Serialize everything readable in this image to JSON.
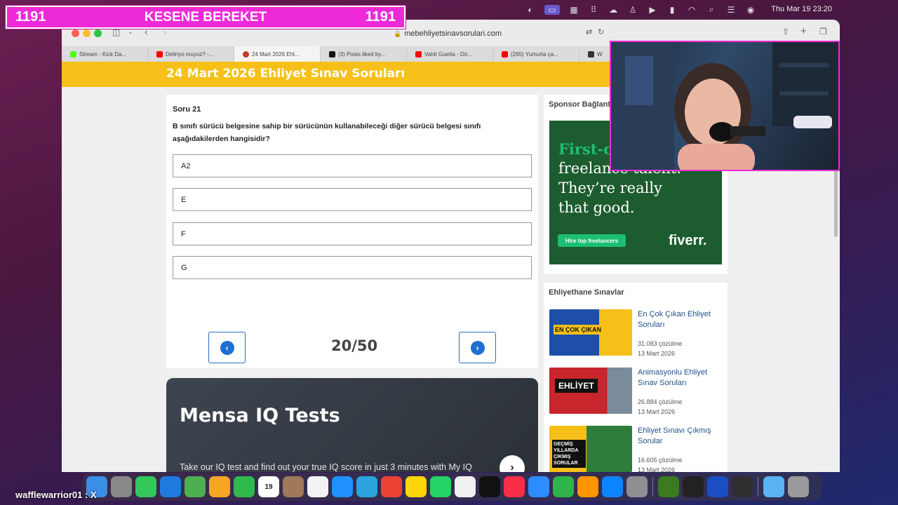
{
  "overlay": {
    "left_count": "1191",
    "title": "KESENE BEREKET",
    "right_count": "1191"
  },
  "menubar": {
    "clock": "Thu Mar 19  23:20"
  },
  "browser": {
    "url": "mebehliyetsinavsorulari.com",
    "tabs": [
      {
        "label": "Stream - Kick Da...",
        "color": "#53fc18"
      },
      {
        "label": "Deliriyo muyuz? -...",
        "color": "#ff0000"
      },
      {
        "label": "24 Mart 2026 Ehl...",
        "color": "#c0392b"
      },
      {
        "label": "(3) Posts liked by...",
        "color": "#111111"
      },
      {
        "label": "Vahit Guetta - Dö...",
        "color": "#ff0000"
      },
      {
        "label": "(265) Yumurta ça...",
        "color": "#ff0000"
      },
      {
        "label": "W",
        "color": "#333333"
      }
    ]
  },
  "page": {
    "title": "24 Mart 2026 Ehliyet Sınav Soruları",
    "question": {
      "number": "Soru 21",
      "text": "B sınıfı sürücü belgesine sahip bir sürücünün kullanabileceği diğer sürücü belgesi sınıfı aşağıdakilerden hangisidir?",
      "options": [
        "A2",
        "E",
        "F",
        "G"
      ]
    },
    "progress": "20/50",
    "mensa": {
      "title": "Mensa IQ Tests",
      "desc": "Take our IQ test and find out your true IQ score in just 3 minutes with My IQ"
    },
    "sponsor": {
      "heading": "Sponsor Bağlantı",
      "ad": {
        "line1": "First-cl",
        "line2": "freelance talent.",
        "line3": "They’re really",
        "line4": "that good.",
        "button": "Hire top freelancers",
        "logo": "fiverr."
      }
    },
    "exams": {
      "heading": "Ehliyethane Sınavlar",
      "items": [
        {
          "title": "En Çok Çıkan Ehliyet Soruları",
          "count": "31.083 çözülme",
          "date": "13 Mart 2026",
          "thumb": "EN ÇOK ÇIKAN"
        },
        {
          "title": "Animasyonlu Ehliyet Sınav Soruları",
          "count": "26.884 çözülme",
          "date": "13 Mart 2026",
          "thumb": "EHLİYET"
        },
        {
          "title": "Ehliyet Sınavı Çıkmış Sorular",
          "count": "16.605 çözülme",
          "date": "13 Mart 2026",
          "thumb": "GEÇMİŞ YILLARDA ÇIKMIŞ SORULAR"
        }
      ]
    }
  },
  "chat": {
    "text": "wafflewarrior01 : X"
  },
  "dock": {
    "apps": [
      {
        "name": "finder-icon",
        "color": "#3a8ee6"
      },
      {
        "name": "launchpad-icon",
        "color": "#888888"
      },
      {
        "name": "messages-icon",
        "color": "#34c759"
      },
      {
        "name": "mail-icon",
        "color": "#1f7ae0"
      },
      {
        "name": "maps-icon",
        "color": "#4caf50"
      },
      {
        "name": "photos-icon",
        "color": "#f5a623"
      },
      {
        "name": "facetime-icon",
        "color": "#30b94d"
      },
      {
        "name": "calendar-icon",
        "color": "#ffffff"
      },
      {
        "name": "notes-brown-icon",
        "color": "#a0785a"
      },
      {
        "name": "reminders-icon",
        "color": "#f2f2f2"
      },
      {
        "name": "safari-icon",
        "color": "#1e90ff"
      },
      {
        "name": "telegram-icon",
        "color": "#2aa3de"
      },
      {
        "name": "chrome-icon",
        "color": "#ea4335"
      },
      {
        "name": "notes-icon",
        "color": "#ffd60a"
      },
      {
        "name": "whatsapp-icon",
        "color": "#25d366"
      },
      {
        "name": "freeform-icon",
        "color": "#f0f0f0"
      },
      {
        "name": "appletv-icon",
        "color": "#111111"
      },
      {
        "name": "music-icon",
        "color": "#fa2d48"
      },
      {
        "name": "keynote-icon",
        "color": "#2d8cff"
      },
      {
        "name": "numbers-icon",
        "color": "#2fb34a"
      },
      {
        "name": "pages-icon",
        "color": "#ff9500"
      },
      {
        "name": "appstore-icon",
        "color": "#0d84ff"
      },
      {
        "name": "settings-icon",
        "color": "#8e8e93"
      },
      {
        "name": "mt-icon",
        "color": "#3b7a1e"
      },
      {
        "name": "epicgames-icon",
        "color": "#222222"
      },
      {
        "name": "wd-icon",
        "color": "#1a4fc4"
      },
      {
        "name": "obs-icon",
        "color": "#302e31"
      },
      {
        "name": "folder-icon",
        "color": "#5ab3f2"
      },
      {
        "name": "trash-icon",
        "color": "#9a9a9a"
      }
    ]
  }
}
